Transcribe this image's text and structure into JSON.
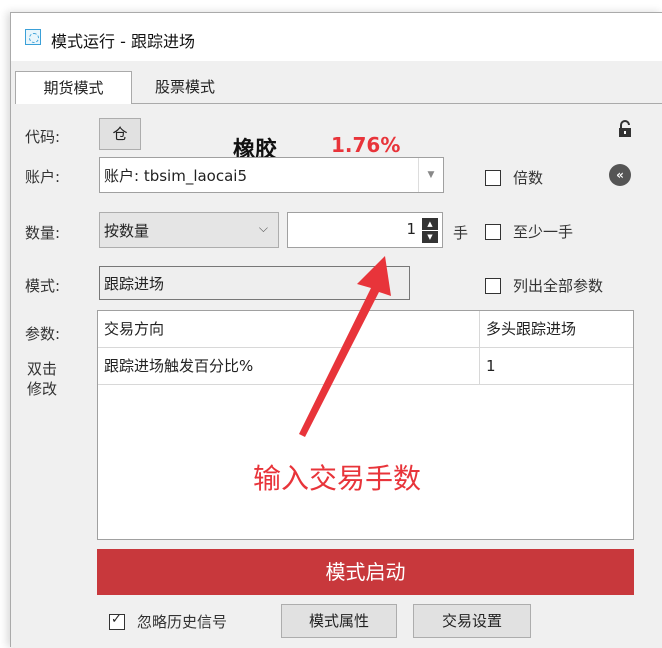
{
  "window": {
    "title": "模式运行 - 跟踪进场"
  },
  "tabs": [
    "期货模式",
    "股票模式"
  ],
  "code": {
    "label": "代码:",
    "button": "仓",
    "name": "橡胶",
    "change": "1.76%"
  },
  "account": {
    "label": "账户:",
    "value": "账户: tbsim_laocai5"
  },
  "quantity": {
    "label": "数量:",
    "mode": "按数量",
    "value": "1",
    "unit": "手"
  },
  "mode": {
    "label": "模式:",
    "value": "跟踪进场"
  },
  "options": {
    "multiple": "倍数",
    "at_least_one": "至少一手",
    "list_all": "列出全部参数"
  },
  "params": {
    "label": "参数:",
    "hint": "双击\n修改",
    "rows": [
      {
        "name": "交易方向",
        "value": "多头跟踪进场"
      },
      {
        "name": "跟踪进场触发百分比%",
        "value": "1"
      }
    ]
  },
  "annotation": "输入交易手数",
  "start_button": "模式启动",
  "bottom": {
    "ignore_history": "忽略历史信号",
    "ignore_checked": true,
    "mode_props": "模式属性",
    "trade_settings": "交易设置"
  },
  "colors": {
    "accent_red": "#e8343a",
    "start_button": "#c8383c"
  }
}
